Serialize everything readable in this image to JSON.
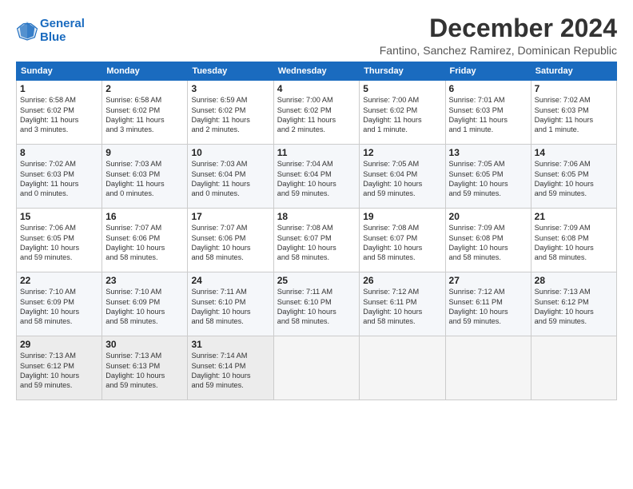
{
  "header": {
    "logo_line1": "General",
    "logo_line2": "Blue",
    "title": "December 2024",
    "location": "Fantino, Sanchez Ramirez, Dominican Republic"
  },
  "days_of_week": [
    "Sunday",
    "Monday",
    "Tuesday",
    "Wednesday",
    "Thursday",
    "Friday",
    "Saturday"
  ],
  "weeks": [
    [
      {
        "day": "1",
        "info": "Sunrise: 6:58 AM\nSunset: 6:02 PM\nDaylight: 11 hours\nand 3 minutes."
      },
      {
        "day": "2",
        "info": "Sunrise: 6:58 AM\nSunset: 6:02 PM\nDaylight: 11 hours\nand 3 minutes."
      },
      {
        "day": "3",
        "info": "Sunrise: 6:59 AM\nSunset: 6:02 PM\nDaylight: 11 hours\nand 2 minutes."
      },
      {
        "day": "4",
        "info": "Sunrise: 7:00 AM\nSunset: 6:02 PM\nDaylight: 11 hours\nand 2 minutes."
      },
      {
        "day": "5",
        "info": "Sunrise: 7:00 AM\nSunset: 6:02 PM\nDaylight: 11 hours\nand 1 minute."
      },
      {
        "day": "6",
        "info": "Sunrise: 7:01 AM\nSunset: 6:03 PM\nDaylight: 11 hours\nand 1 minute."
      },
      {
        "day": "7",
        "info": "Sunrise: 7:02 AM\nSunset: 6:03 PM\nDaylight: 11 hours\nand 1 minute."
      }
    ],
    [
      {
        "day": "8",
        "info": "Sunrise: 7:02 AM\nSunset: 6:03 PM\nDaylight: 11 hours\nand 0 minutes."
      },
      {
        "day": "9",
        "info": "Sunrise: 7:03 AM\nSunset: 6:03 PM\nDaylight: 11 hours\nand 0 minutes."
      },
      {
        "day": "10",
        "info": "Sunrise: 7:03 AM\nSunset: 6:04 PM\nDaylight: 11 hours\nand 0 minutes."
      },
      {
        "day": "11",
        "info": "Sunrise: 7:04 AM\nSunset: 6:04 PM\nDaylight: 10 hours\nand 59 minutes."
      },
      {
        "day": "12",
        "info": "Sunrise: 7:05 AM\nSunset: 6:04 PM\nDaylight: 10 hours\nand 59 minutes."
      },
      {
        "day": "13",
        "info": "Sunrise: 7:05 AM\nSunset: 6:05 PM\nDaylight: 10 hours\nand 59 minutes."
      },
      {
        "day": "14",
        "info": "Sunrise: 7:06 AM\nSunset: 6:05 PM\nDaylight: 10 hours\nand 59 minutes."
      }
    ],
    [
      {
        "day": "15",
        "info": "Sunrise: 7:06 AM\nSunset: 6:05 PM\nDaylight: 10 hours\nand 59 minutes."
      },
      {
        "day": "16",
        "info": "Sunrise: 7:07 AM\nSunset: 6:06 PM\nDaylight: 10 hours\nand 58 minutes."
      },
      {
        "day": "17",
        "info": "Sunrise: 7:07 AM\nSunset: 6:06 PM\nDaylight: 10 hours\nand 58 minutes."
      },
      {
        "day": "18",
        "info": "Sunrise: 7:08 AM\nSunset: 6:07 PM\nDaylight: 10 hours\nand 58 minutes."
      },
      {
        "day": "19",
        "info": "Sunrise: 7:08 AM\nSunset: 6:07 PM\nDaylight: 10 hours\nand 58 minutes."
      },
      {
        "day": "20",
        "info": "Sunrise: 7:09 AM\nSunset: 6:08 PM\nDaylight: 10 hours\nand 58 minutes."
      },
      {
        "day": "21",
        "info": "Sunrise: 7:09 AM\nSunset: 6:08 PM\nDaylight: 10 hours\nand 58 minutes."
      }
    ],
    [
      {
        "day": "22",
        "info": "Sunrise: 7:10 AM\nSunset: 6:09 PM\nDaylight: 10 hours\nand 58 minutes."
      },
      {
        "day": "23",
        "info": "Sunrise: 7:10 AM\nSunset: 6:09 PM\nDaylight: 10 hours\nand 58 minutes."
      },
      {
        "day": "24",
        "info": "Sunrise: 7:11 AM\nSunset: 6:10 PM\nDaylight: 10 hours\nand 58 minutes."
      },
      {
        "day": "25",
        "info": "Sunrise: 7:11 AM\nSunset: 6:10 PM\nDaylight: 10 hours\nand 58 minutes."
      },
      {
        "day": "26",
        "info": "Sunrise: 7:12 AM\nSunset: 6:11 PM\nDaylight: 10 hours\nand 58 minutes."
      },
      {
        "day": "27",
        "info": "Sunrise: 7:12 AM\nSunset: 6:11 PM\nDaylight: 10 hours\nand 59 minutes."
      },
      {
        "day": "28",
        "info": "Sunrise: 7:13 AM\nSunset: 6:12 PM\nDaylight: 10 hours\nand 59 minutes."
      }
    ],
    [
      {
        "day": "29",
        "info": "Sunrise: 7:13 AM\nSunset: 6:12 PM\nDaylight: 10 hours\nand 59 minutes."
      },
      {
        "day": "30",
        "info": "Sunrise: 7:13 AM\nSunset: 6:13 PM\nDaylight: 10 hours\nand 59 minutes."
      },
      {
        "day": "31",
        "info": "Sunrise: 7:14 AM\nSunset: 6:14 PM\nDaylight: 10 hours\nand 59 minutes."
      },
      {
        "day": "",
        "info": ""
      },
      {
        "day": "",
        "info": ""
      },
      {
        "day": "",
        "info": ""
      },
      {
        "day": "",
        "info": ""
      }
    ]
  ]
}
